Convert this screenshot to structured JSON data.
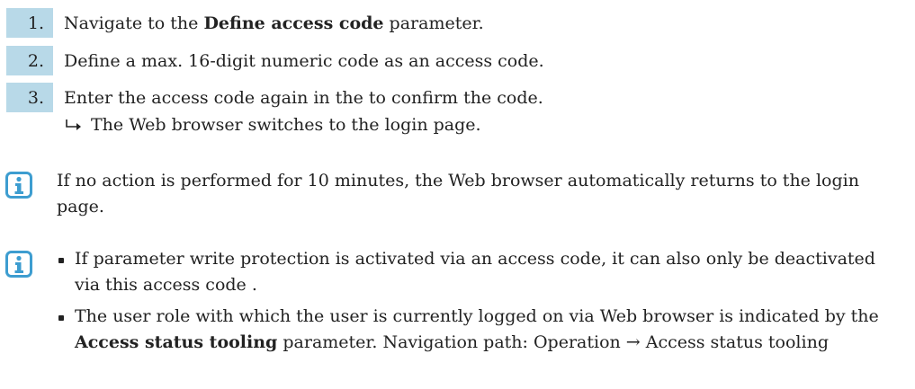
{
  "steps": [
    {
      "number": "1.",
      "text_before": "Navigate to the ",
      "bold": "Define access code",
      "text_after": " parameter."
    },
    {
      "number": "2.",
      "text": "Define a max. 16-digit numeric code as an access code."
    },
    {
      "number": "3.",
      "text": "Enter the access code again in the to confirm the code."
    }
  ],
  "result": {
    "arrow_icon": "result-arrow-icon",
    "text": "The Web browser switches to the login page."
  },
  "note1": {
    "icon": "info-icon",
    "text": "If no action is performed for 10 minutes, the Web browser automatically returns to the login page."
  },
  "note2": {
    "icon": "info-icon",
    "bullets": [
      {
        "text": "If parameter write protection is activated via an access code, it can also only be deactivated via this access code ."
      },
      {
        "text_before": "The user role with which the user is currently logged on via Web browser is indicated by the ",
        "bold": "Access status tooling",
        "text_after": " parameter. Navigation path: Operation → Access status tooling"
      }
    ]
  },
  "colors": {
    "step_badge": "#b8d9e8",
    "info_icon": "#3d9dd0",
    "text": "#222222"
  }
}
